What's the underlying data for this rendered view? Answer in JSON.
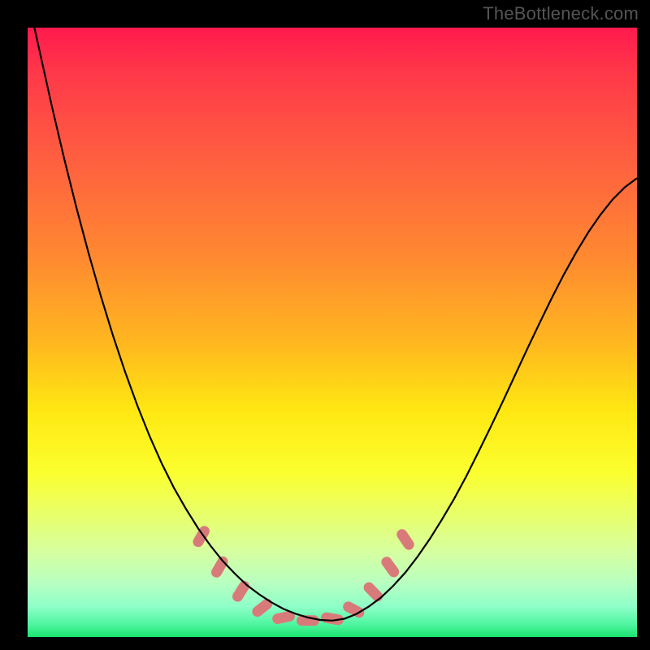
{
  "watermark": "TheBottleneck.com",
  "colors": {
    "frame": "#000000",
    "marker": "#d97a7a",
    "curve": "#000000",
    "gradient_top": "#ff1a4d",
    "gradient_bottom": "#19e46f"
  },
  "chart_data": {
    "type": "line",
    "title": "",
    "xlabel": "",
    "ylabel": "",
    "xlim": [
      0,
      100
    ],
    "ylim": [
      0,
      100
    ],
    "x": [
      0,
      2,
      4,
      6,
      8,
      10,
      12,
      14,
      16,
      18,
      20,
      22,
      24,
      26,
      28,
      30,
      32,
      34,
      36,
      38,
      40,
      42,
      44,
      46,
      48,
      50,
      52,
      54,
      56,
      58,
      60,
      62,
      64,
      66,
      68,
      70,
      72,
      74,
      76,
      78,
      80,
      82,
      84,
      86,
      88,
      90,
      92,
      94,
      96,
      98,
      100
    ],
    "values": [
      105,
      96,
      87,
      78.5,
      70.5,
      63,
      56,
      49.5,
      43.5,
      38,
      33,
      28.5,
      24.5,
      21,
      17.8,
      15,
      12.5,
      10.4,
      8.5,
      7,
      5.7,
      4.6,
      3.8,
      3.2,
      2.8,
      2.7,
      3,
      3.8,
      5,
      6.5,
      8.4,
      10.6,
      13.2,
      16.1,
      19.3,
      22.7,
      26.4,
      30.4,
      34.5,
      38.7,
      43,
      47.3,
      51.5,
      55.6,
      59.5,
      63.1,
      66.4,
      69.3,
      71.8,
      73.8,
      75.3
    ],
    "markers": [
      {
        "x": 28.5,
        "y": 16.5,
        "angle": 60
      },
      {
        "x": 31.5,
        "y": 11.5,
        "angle": 60
      },
      {
        "x": 35.0,
        "y": 7.5,
        "angle": 58
      },
      {
        "x": 38.5,
        "y": 4.8,
        "angle": 38
      },
      {
        "x": 42.0,
        "y": 3.2,
        "angle": 12
      },
      {
        "x": 46.0,
        "y": 2.7,
        "angle": 0
      },
      {
        "x": 50.0,
        "y": 3.0,
        "angle": -10
      },
      {
        "x": 53.5,
        "y": 4.5,
        "angle": -28
      },
      {
        "x": 56.7,
        "y": 7.4,
        "angle": -46
      },
      {
        "x": 59.5,
        "y": 11.5,
        "angle": -54
      },
      {
        "x": 62.0,
        "y": 16.0,
        "angle": -56
      }
    ],
    "grid": false,
    "legend": null,
    "annotations": []
  }
}
